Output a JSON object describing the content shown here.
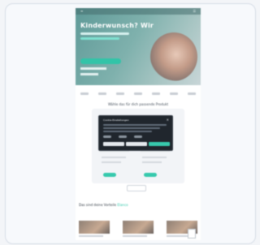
{
  "hero": {
    "logo": "≡",
    "headline": "Kinderwunsch? Wir",
    "menu": "☰"
  },
  "plans_section": {
    "title": "Wähle das für dich passende Produkt"
  },
  "consent": {
    "title": "Cookie-Einstellungen",
    "close": "×"
  },
  "articles": {
    "title_prefix": "Das sind deine Vorteile",
    "title_highlight": "Elanco"
  },
  "colors": {
    "accent": "#37c9ad",
    "hero": "#7fb1ad",
    "consent_bg": "#20262d"
  }
}
